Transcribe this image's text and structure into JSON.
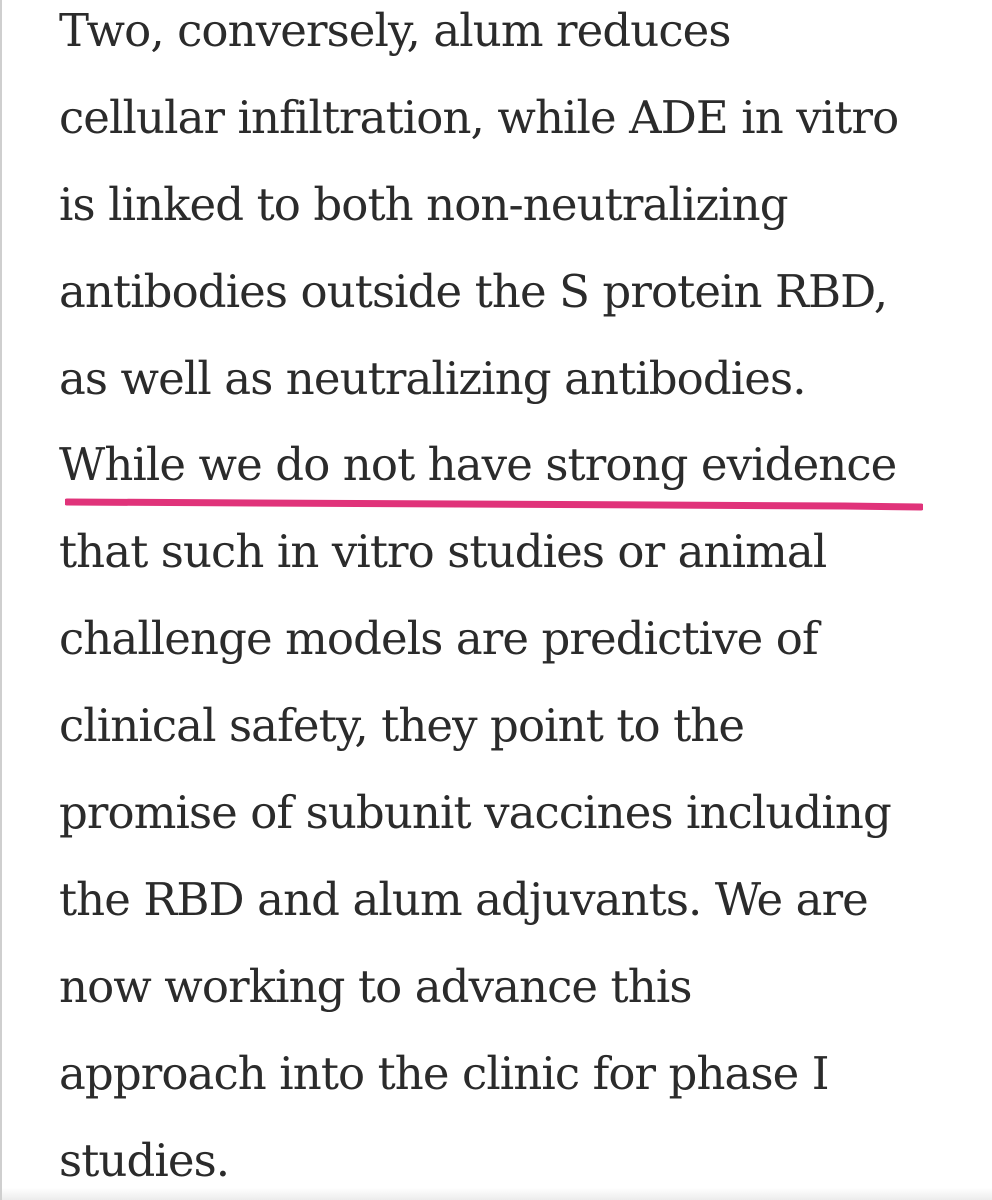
{
  "article": {
    "lines": [
      "Two, conversely, alum reduces",
      "cellular infiltration, while ADE in vitro",
      "is linked to both non-neutralizing",
      "antibodies outside the S protein RBD,",
      "as well as neutralizing antibodies.",
      "While we do not have strong evidence",
      "that such in vitro studies or animal",
      "challenge models are predictive of",
      "clinical safety, they point to the",
      "promise of subunit vaccines including",
      "the RBD and alum adjuvants. We are",
      "now working to advance this",
      "approach into the clinic for phase I",
      "studies."
    ],
    "highlighted_line_index": 5
  },
  "colors": {
    "text": "#2b2b2b",
    "underline": "#e0337a",
    "background": "#ffffff"
  }
}
